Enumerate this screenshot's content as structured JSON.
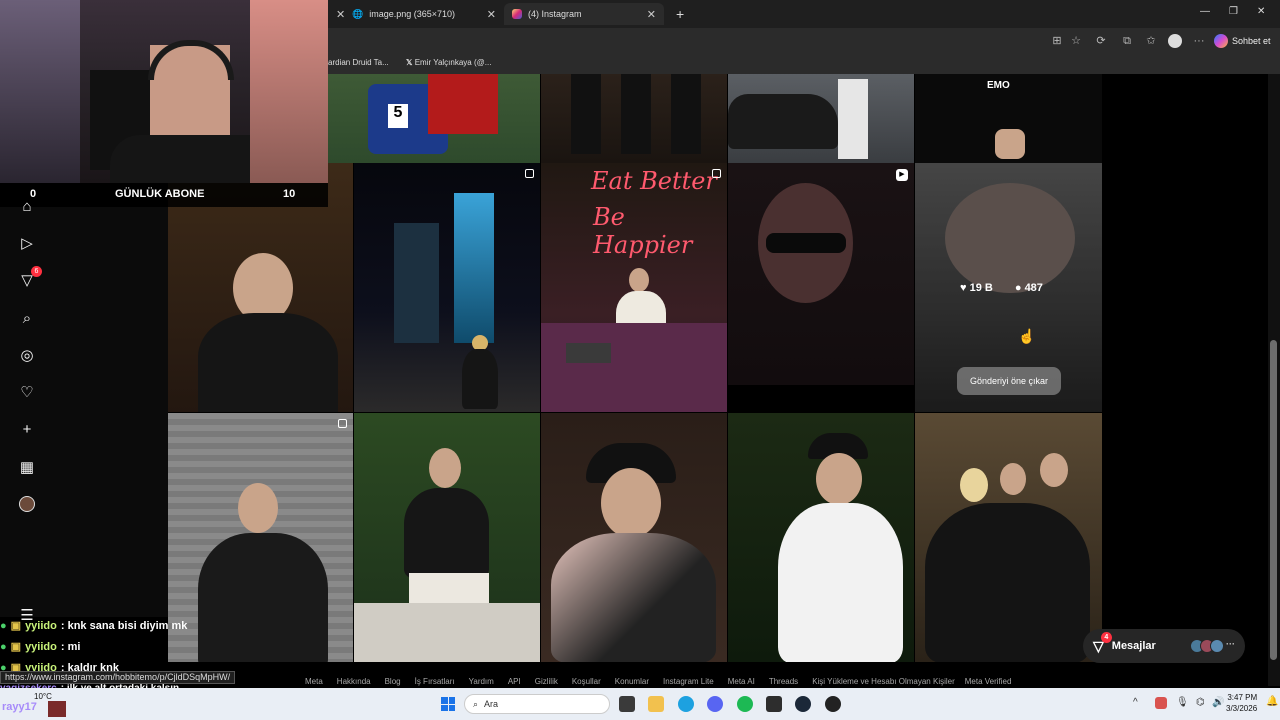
{
  "browser": {
    "tabs": [
      {
        "label": "image.png (365×710)"
      },
      {
        "label": "(4) Instagram"
      }
    ],
    "new_tab": "+",
    "bookmarks": [
      "ardian Druid Ta...",
      "Emir Yalçınkaya (@..."
    ],
    "copilot_label": "Sohbet et",
    "window_controls": {
      "minimize": "—",
      "restore": "❐",
      "close": "✕"
    }
  },
  "overlay": {
    "sub_counter": {
      "left_value": "0",
      "title": "GÜNLÜK ABONE",
      "right_value": "10"
    }
  },
  "sidebar": {
    "notifications_badge": "6"
  },
  "post_hover": {
    "likes": "19 B",
    "comments": "487",
    "promote_button": "Gönderiyi öne çıkar"
  },
  "chat": [
    {
      "user": "yyiido",
      "message": ": knk sana bisi diyim mk"
    },
    {
      "user": "yyiido",
      "message": ": mi"
    },
    {
      "user": "yyiido",
      "message": ": kaldır knk"
    },
    {
      "user": "yagizsekerc",
      "message": ": ilk ye alt ortadaki kalsın"
    }
  ],
  "chat_user_partial": "rayy17",
  "status_url": "https://www.instagram.com/hobbitemo/p/CjldDSqMpHW/",
  "footer_links": [
    "Meta",
    "Hakkında",
    "Blog",
    "İş Fırsatları",
    "Yardım",
    "API",
    "Gizlilik",
    "Koşullar",
    "Konumlar",
    "Instagram Lite",
    "Meta AI",
    "Threads",
    "Kişi Yükleme ve Hesabı Olmayan Kişiler",
    "Meta Verified"
  ],
  "messages": {
    "label": "Mesajlar",
    "badge": "4"
  },
  "taskbar": {
    "search_placeholder": "Ara",
    "weather": "10°C",
    "time": "3:47 PM",
    "date": "3/3/2026"
  },
  "tile_text": {
    "emo": "EMO",
    "sign_line1": "Eat Better",
    "sign_line2": "Be Happier"
  },
  "colors": {
    "ig_bg": "#000000",
    "badge_red": "#ff3040",
    "pill_bg": "#262626"
  }
}
